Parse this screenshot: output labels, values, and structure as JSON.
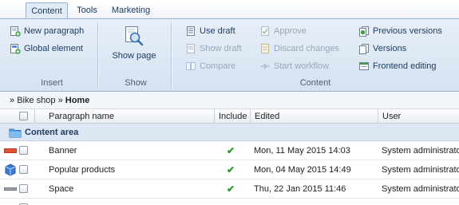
{
  "tabs": [
    {
      "label": "Content",
      "active": true
    },
    {
      "label": "Tools",
      "active": false
    },
    {
      "label": "Marketing",
      "active": false
    }
  ],
  "ribbon": {
    "insert": {
      "label": "Insert",
      "new_paragraph": "New paragraph",
      "global_element": "Global element"
    },
    "show": {
      "label": "Show",
      "show_page": "Show page"
    },
    "content": {
      "label": "Content",
      "use_draft": "Use draft",
      "show_draft": "Show draft",
      "compare": "Compare",
      "approve": "Approve",
      "discard_changes": "Discard changes",
      "start_workflow": "Start workflow",
      "previous_versions": "Previous versions",
      "versions": "Versions",
      "frontend_editing": "Frontend editing"
    }
  },
  "breadcrumb": {
    "sep1": "»",
    "shop": "Bike shop",
    "sep2": "»",
    "current": "Home"
  },
  "grid": {
    "columns": {
      "name": "Paragraph name",
      "include": "Include",
      "edited": "Edited",
      "user": "User"
    },
    "group_label": "Content area",
    "rows": [
      {
        "icon": "banner-icon",
        "name": "Banner",
        "include": "✔",
        "edited": "Mon, 11 May 2015 14:03",
        "user": "System administrator"
      },
      {
        "icon": "module-icon",
        "name": "Popular products",
        "include": "✔",
        "edited": "Mon, 04 May 2015 14:49",
        "user": "System administrator"
      },
      {
        "icon": "spacer-icon",
        "name": "Space",
        "include": "✔",
        "edited": "Thu, 22 Jan 2015 11:46",
        "user": "System administrator"
      }
    ]
  },
  "colors": {
    "accent": "#1f3c63",
    "ribbon": "#dbe6f3",
    "check": "#2a9a2a"
  }
}
